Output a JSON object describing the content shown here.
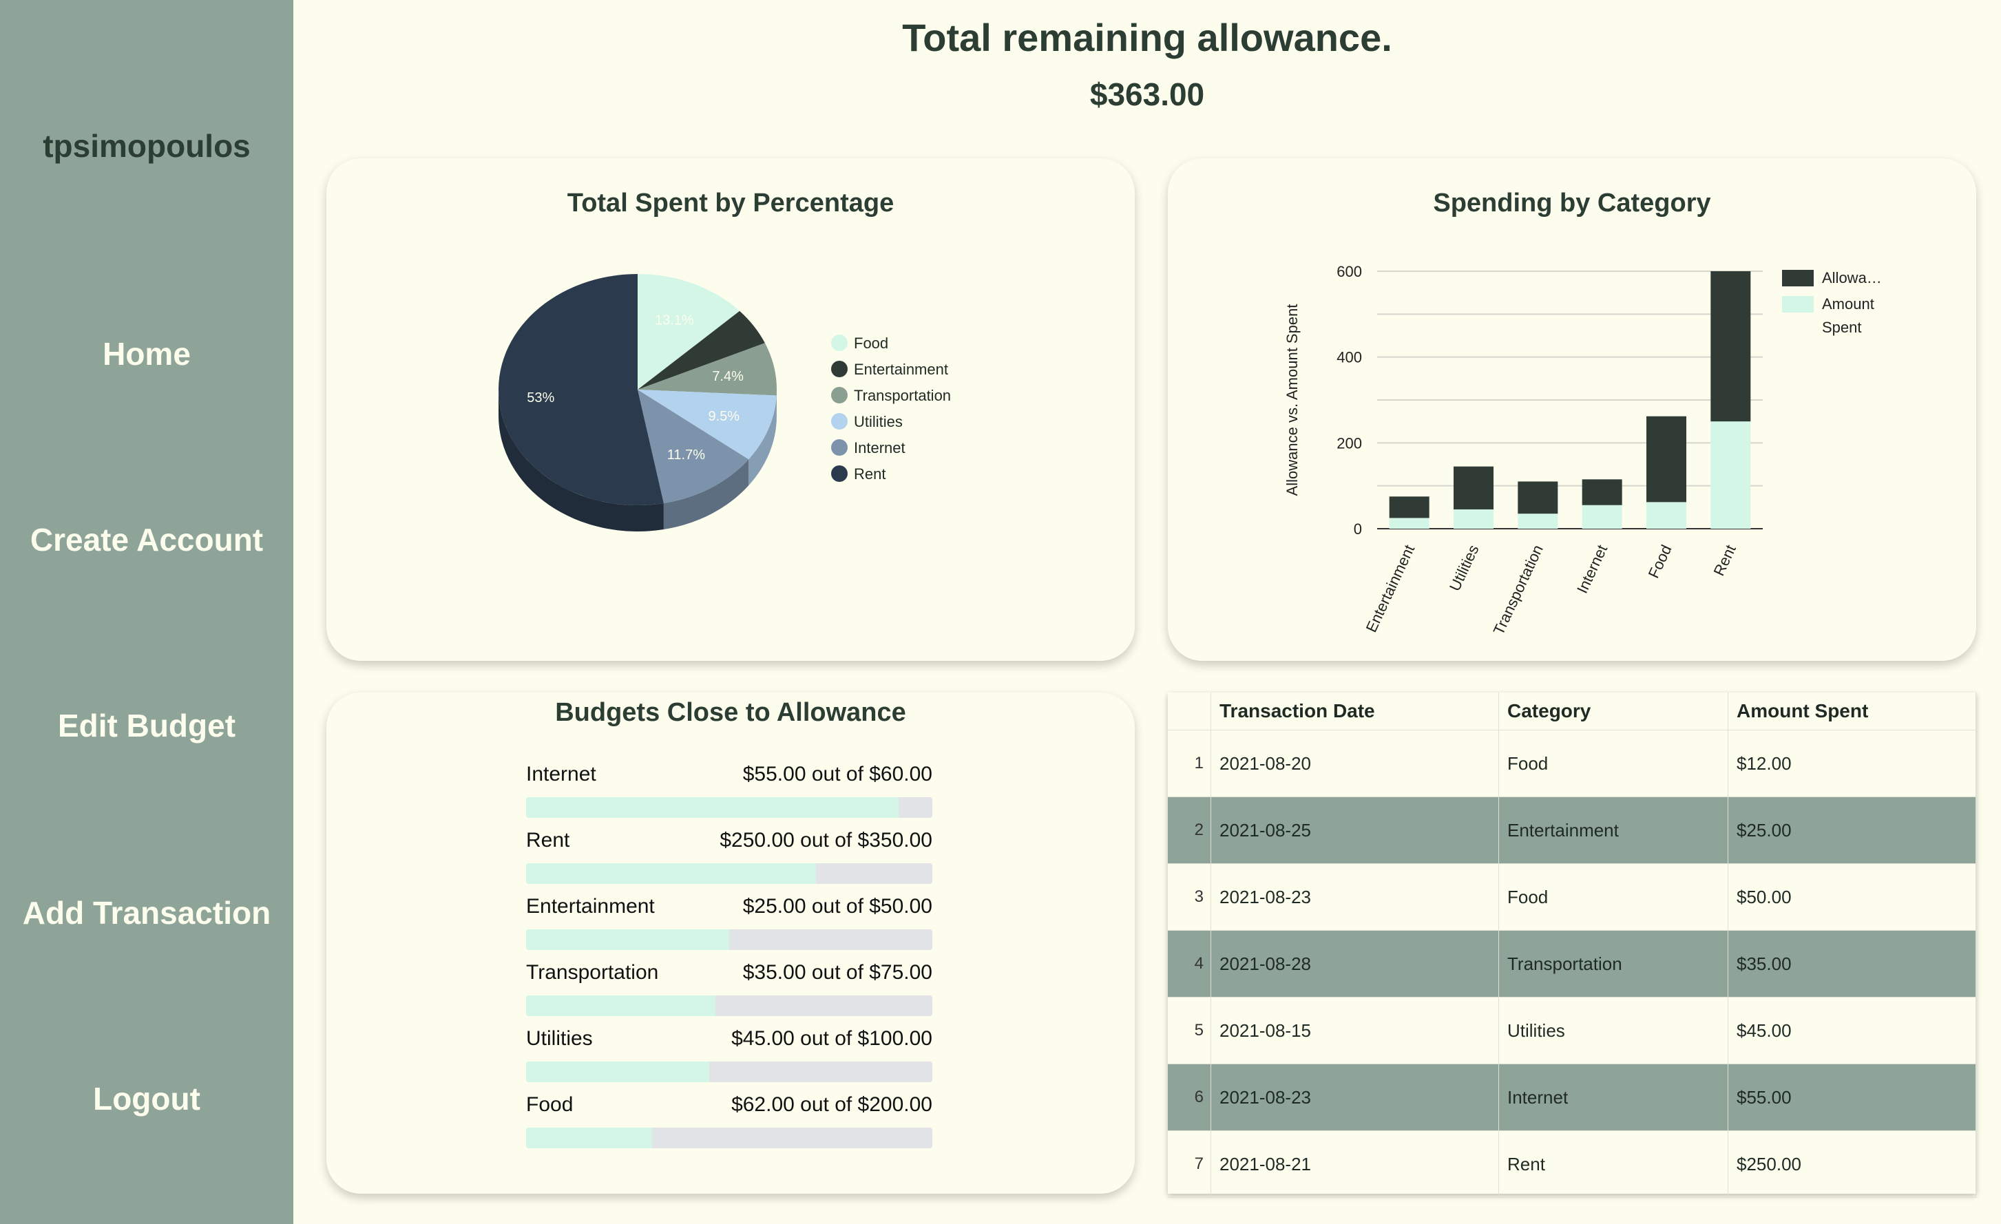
{
  "sidebar": {
    "username": "tpsimopoulos",
    "items": [
      {
        "label": "Home"
      },
      {
        "label": "Create Account"
      },
      {
        "label": "Edit Budget"
      },
      {
        "label": "Add Transaction"
      },
      {
        "label": "Logout"
      }
    ]
  },
  "header": {
    "title": "Total remaining allowance.",
    "amount": "$363.00"
  },
  "colors": {
    "sidebar_bg": "#8fa498",
    "page_bg": "#fdfdee",
    "dark_text": "#2c3d33",
    "allowance": "#2f3b34",
    "amount_spent": "#d4f6e6"
  },
  "chart_data": [
    {
      "type": "pie",
      "title": "Total Spent by Percentage",
      "categories": [
        "Food",
        "Entertainment",
        "Transportation",
        "Utilities",
        "Internet",
        "Rent"
      ],
      "values": [
        13.1,
        5.3,
        7.4,
        9.5,
        11.7,
        53
      ],
      "data_labels": [
        "13.1%",
        "",
        "7.4%",
        "9.5%",
        "11.7%",
        "53%"
      ],
      "colors": [
        "#d4f6e6",
        "#2f3b34",
        "#8b9e92",
        "#b2d2ee",
        "#7c93ab",
        "#2b3b4d"
      ],
      "legend_position": "right"
    },
    {
      "type": "bar",
      "stacked": true,
      "title": "Spending by Category",
      "categories": [
        "Entertainment",
        "Utilities",
        "Transportation",
        "Internet",
        "Food",
        "Rent"
      ],
      "series": [
        {
          "name": "Amount Spent",
          "values": [
            25,
            45,
            35,
            55,
            62,
            250
          ],
          "color": "#d4f6e6"
        },
        {
          "name": "Allowance",
          "values": [
            50,
            100,
            75,
            60,
            200,
            350
          ],
          "color": "#2f3b34"
        }
      ],
      "legend_labels": [
        "Allowa…",
        "Amount Spent"
      ],
      "ylabel": "Allowance vs. Amount Spent",
      "ylim": [
        0,
        600
      ],
      "yticks": [
        0,
        200,
        400,
        600
      ],
      "grid": true,
      "legend_position": "right"
    }
  ],
  "budgets": {
    "title": "Budgets Close to Allowance",
    "items": [
      {
        "name": "Internet",
        "amount": "$55.00 out of $60.00",
        "progress": 0.9167
      },
      {
        "name": "Rent",
        "amount": "$250.00 out of $350.00",
        "progress": 0.7143
      },
      {
        "name": "Entertainment",
        "amount": "$25.00 out of $50.00",
        "progress": 0.5
      },
      {
        "name": "Transportation",
        "amount": "$35.00 out of $75.00",
        "progress": 0.4667
      },
      {
        "name": "Utilities",
        "amount": "$45.00 out of $100.00",
        "progress": 0.45
      },
      {
        "name": "Food",
        "amount": "$62.00 out of $200.00",
        "progress": 0.31
      }
    ]
  },
  "transactions": {
    "columns": [
      "Transaction Date",
      "Category",
      "Amount Spent"
    ],
    "rows": [
      {
        "index": "1",
        "date": "2021-08-20",
        "category": "Food",
        "amount": "$12.00"
      },
      {
        "index": "2",
        "date": "2021-08-25",
        "category": "Entertainment",
        "amount": "$25.00"
      },
      {
        "index": "3",
        "date": "2021-08-23",
        "category": "Food",
        "amount": "$50.00"
      },
      {
        "index": "4",
        "date": "2021-08-28",
        "category": "Transportation",
        "amount": "$35.00"
      },
      {
        "index": "5",
        "date": "2021-08-15",
        "category": "Utilities",
        "amount": "$45.00"
      },
      {
        "index": "6",
        "date": "2021-08-23",
        "category": "Internet",
        "amount": "$55.00"
      },
      {
        "index": "7",
        "date": "2021-08-21",
        "category": "Rent",
        "amount": "$250.00"
      }
    ]
  }
}
